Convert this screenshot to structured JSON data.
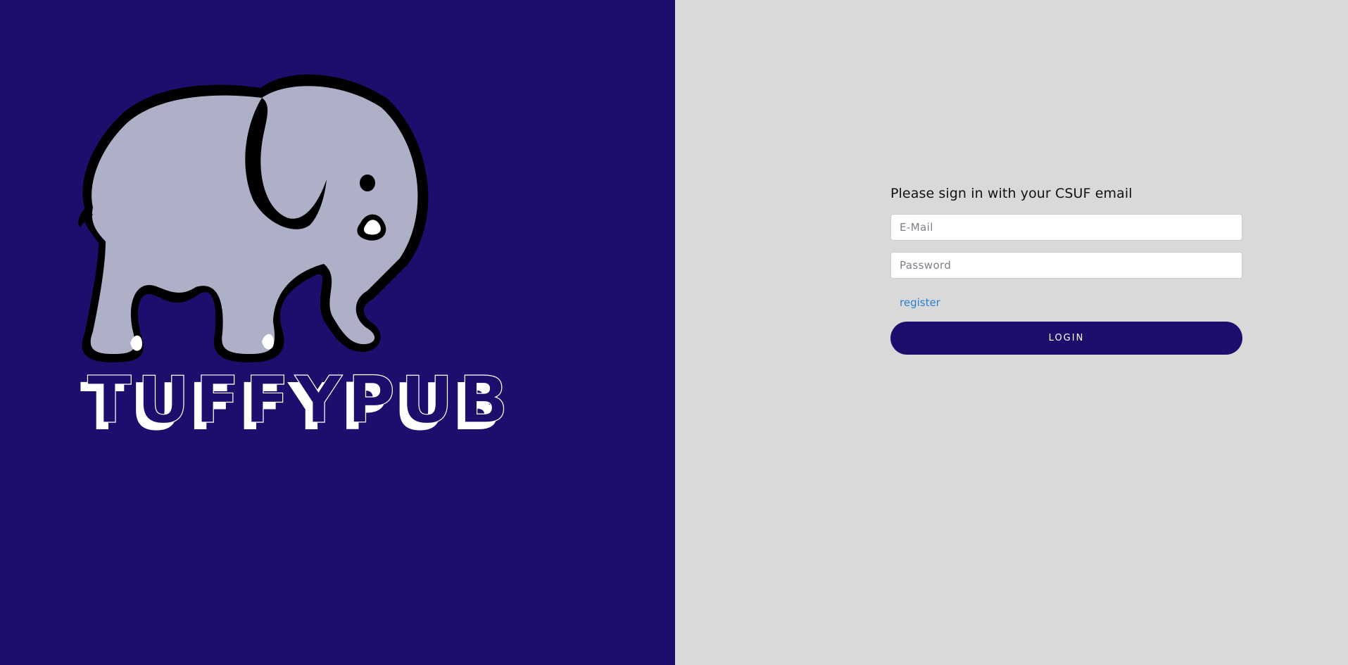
{
  "colors": {
    "left_bg": "#1f0d6e",
    "right_bg": "#d9d9d9",
    "button_bg": "#1f0d6e",
    "link": "#2d7fd4",
    "elephant_body": "#aeb0c8",
    "elephant_outline": "#000000"
  },
  "logo": {
    "icon": "elephant-icon",
    "wordmark": "TUFFYPUB"
  },
  "login": {
    "prompt": "Please sign in with your CSUF email",
    "email_placeholder": "E-Mail",
    "password_placeholder": "Password",
    "register_label": "register",
    "login_label": "LOGIN"
  }
}
